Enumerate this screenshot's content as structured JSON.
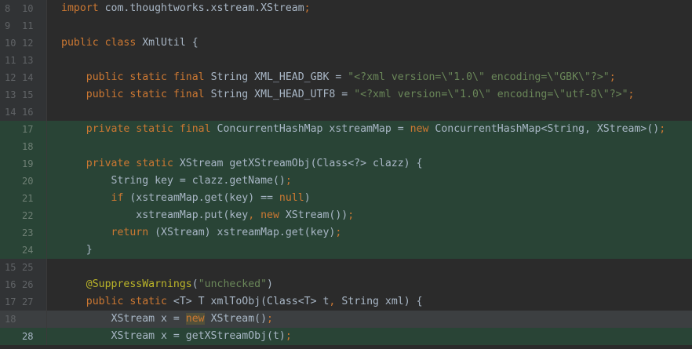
{
  "colors": {
    "background": "#2b2b2b",
    "added_background": "#294436",
    "removed_background": "#3c3f41",
    "keyword": "#cc7832",
    "string": "#6a8759",
    "annotation": "#bbb529",
    "text": "#a9b7c6"
  },
  "lines": [
    {
      "old": "8",
      "new": "10",
      "status": "unchanged",
      "tokens": [
        {
          "t": "import",
          "c": "kw"
        },
        {
          "t": " com.thoughtworks.xstream.XStream",
          "c": ""
        },
        {
          "t": ";",
          "c": "kw"
        }
      ]
    },
    {
      "old": "9",
      "new": "11",
      "status": "unchanged",
      "tokens": []
    },
    {
      "old": "10",
      "new": "12",
      "status": "unchanged",
      "tokens": [
        {
          "t": "public class",
          "c": "kw"
        },
        {
          "t": " XmlUtil {",
          "c": ""
        }
      ]
    },
    {
      "old": "11",
      "new": "13",
      "status": "unchanged",
      "tokens": []
    },
    {
      "old": "12",
      "new": "14",
      "status": "unchanged",
      "tokens": [
        {
          "t": "    ",
          "c": ""
        },
        {
          "t": "public static final",
          "c": "kw"
        },
        {
          "t": " String XML_HEAD_GBK = ",
          "c": ""
        },
        {
          "t": "\"<?xml version=\\\"1.0\\\" encoding=\\\"GBK\\\"?>\"",
          "c": "str"
        },
        {
          "t": ";",
          "c": "kw"
        }
      ]
    },
    {
      "old": "13",
      "new": "15",
      "status": "unchanged",
      "tokens": [
        {
          "t": "    ",
          "c": ""
        },
        {
          "t": "public static final",
          "c": "kw"
        },
        {
          "t": " String XML_HEAD_UTF8 = ",
          "c": ""
        },
        {
          "t": "\"<?xml version=\\\"1.0\\\" encoding=\\\"utf-8\\\"?>\"",
          "c": "str"
        },
        {
          "t": ";",
          "c": "kw"
        }
      ]
    },
    {
      "old": "14",
      "new": "16",
      "status": "unchanged",
      "tokens": []
    },
    {
      "old": "",
      "new": "17",
      "status": "added",
      "tokens": [
        {
          "t": "    ",
          "c": ""
        },
        {
          "t": "private static final",
          "c": "kw"
        },
        {
          "t": " ConcurrentHashMap xstreamMap = ",
          "c": ""
        },
        {
          "t": "new",
          "c": "kw"
        },
        {
          "t": " ConcurrentHashMap<String, XStream>()",
          "c": ""
        },
        {
          "t": ";",
          "c": "kw"
        }
      ]
    },
    {
      "old": "",
      "new": "18",
      "status": "added",
      "tokens": []
    },
    {
      "old": "",
      "new": "19",
      "status": "added",
      "tokens": [
        {
          "t": "    ",
          "c": ""
        },
        {
          "t": "private static",
          "c": "kw"
        },
        {
          "t": " XStream getXStreamObj(Class<?> clazz) {",
          "c": ""
        }
      ]
    },
    {
      "old": "",
      "new": "20",
      "status": "added",
      "tokens": [
        {
          "t": "        String key = clazz.getName()",
          "c": ""
        },
        {
          "t": ";",
          "c": "kw"
        }
      ]
    },
    {
      "old": "",
      "new": "21",
      "status": "added",
      "tokens": [
        {
          "t": "        ",
          "c": ""
        },
        {
          "t": "if",
          "c": "kw"
        },
        {
          "t": " (xstreamMap.get(key) == ",
          "c": ""
        },
        {
          "t": "null",
          "c": "kw"
        },
        {
          "t": ")",
          "c": ""
        }
      ]
    },
    {
      "old": "",
      "new": "22",
      "status": "added",
      "tokens": [
        {
          "t": "            xstreamMap.put(key",
          "c": ""
        },
        {
          "t": ", ",
          "c": "kw"
        },
        {
          "t": "new",
          "c": "kw"
        },
        {
          "t": " XStream())",
          "c": ""
        },
        {
          "t": ";",
          "c": "kw"
        }
      ]
    },
    {
      "old": "",
      "new": "23",
      "status": "added",
      "tokens": [
        {
          "t": "        ",
          "c": ""
        },
        {
          "t": "return",
          "c": "kw"
        },
        {
          "t": " (XStream) xstreamMap.get(key)",
          "c": ""
        },
        {
          "t": ";",
          "c": "kw"
        }
      ]
    },
    {
      "old": "",
      "new": "24",
      "status": "added",
      "tokens": [
        {
          "t": "    }",
          "c": ""
        }
      ]
    },
    {
      "old": "15",
      "new": "25",
      "status": "unchanged",
      "tokens": []
    },
    {
      "old": "16",
      "new": "26",
      "status": "unchanged",
      "tokens": [
        {
          "t": "    ",
          "c": ""
        },
        {
          "t": "@SuppressWarnings",
          "c": "ann"
        },
        {
          "t": "(",
          "c": ""
        },
        {
          "t": "\"unchecked\"",
          "c": "str"
        },
        {
          "t": ")",
          "c": ""
        }
      ]
    },
    {
      "old": "17",
      "new": "27",
      "status": "unchanged",
      "tokens": [
        {
          "t": "    ",
          "c": ""
        },
        {
          "t": "public static",
          "c": "kw"
        },
        {
          "t": " <T> T xmlToObj(Class<T> t",
          "c": ""
        },
        {
          "t": ", ",
          "c": "kw"
        },
        {
          "t": "String xml) {",
          "c": ""
        }
      ]
    },
    {
      "old": "18",
      "new": "",
      "status": "removed",
      "tokens": [
        {
          "t": "        XStream x = ",
          "c": ""
        },
        {
          "t": "new",
          "c": "kw hl"
        },
        {
          "t": " XStream()",
          "c": ""
        },
        {
          "t": ";",
          "c": "kw"
        }
      ]
    },
    {
      "old": "",
      "new": "28",
      "status": "current",
      "tokens": [
        {
          "t": "        XStream x = getXStreamObj(t)",
          "c": ""
        },
        {
          "t": ";",
          "c": "kw"
        }
      ]
    }
  ]
}
